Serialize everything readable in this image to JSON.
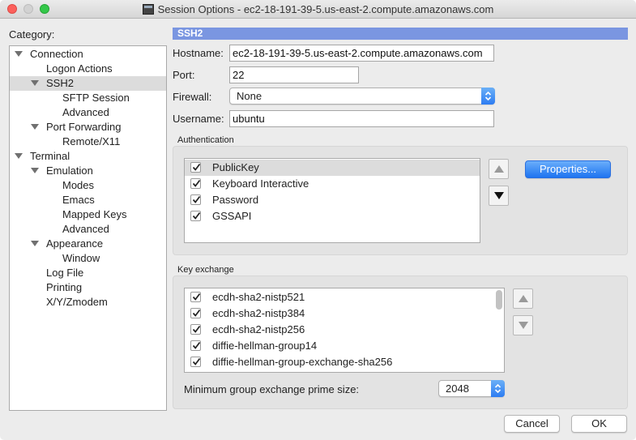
{
  "window": {
    "title": "Session Options - ec2-18-191-39-5.us-east-2.compute.amazonaws.com"
  },
  "category": {
    "label": "Category:",
    "items": [
      {
        "label": "Connection",
        "level": 0,
        "expanded": true,
        "selected": false
      },
      {
        "label": "Logon Actions",
        "level": 1,
        "expanded": false,
        "selected": false
      },
      {
        "label": "SSH2",
        "level": 1,
        "expanded": true,
        "selected": true
      },
      {
        "label": "SFTP Session",
        "level": 2,
        "expanded": false,
        "selected": false
      },
      {
        "label": "Advanced",
        "level": 2,
        "expanded": false,
        "selected": false
      },
      {
        "label": "Port Forwarding",
        "level": 1,
        "expanded": true,
        "selected": false
      },
      {
        "label": "Remote/X11",
        "level": 2,
        "expanded": false,
        "selected": false
      },
      {
        "label": "Terminal",
        "level": 0,
        "expanded": true,
        "selected": false
      },
      {
        "label": "Emulation",
        "level": 1,
        "expanded": true,
        "selected": false
      },
      {
        "label": "Modes",
        "level": 2,
        "expanded": false,
        "selected": false
      },
      {
        "label": "Emacs",
        "level": 2,
        "expanded": false,
        "selected": false
      },
      {
        "label": "Mapped Keys",
        "level": 2,
        "expanded": false,
        "selected": false
      },
      {
        "label": "Advanced",
        "level": 2,
        "expanded": false,
        "selected": false
      },
      {
        "label": "Appearance",
        "level": 1,
        "expanded": true,
        "selected": false
      },
      {
        "label": "Window",
        "level": 2,
        "expanded": false,
        "selected": false
      },
      {
        "label": "Log File",
        "level": 1,
        "expanded": false,
        "selected": false
      },
      {
        "label": "Printing",
        "level": 1,
        "expanded": false,
        "selected": false
      },
      {
        "label": "X/Y/Zmodem",
        "level": 1,
        "expanded": false,
        "selected": false
      }
    ]
  },
  "panel": {
    "header": "SSH2",
    "hostname_label": "Hostname:",
    "hostname_value": "ec2-18-191-39-5.us-east-2.compute.amazonaws.com",
    "port_label": "Port:",
    "port_value": "22",
    "firewall_label": "Firewall:",
    "firewall_value": "None",
    "username_label": "Username:",
    "username_value": "ubuntu"
  },
  "authentication": {
    "title": "Authentication",
    "items": [
      {
        "label": "PublicKey",
        "checked": true,
        "selected": true
      },
      {
        "label": "Keyboard Interactive",
        "checked": true,
        "selected": false
      },
      {
        "label": "Password",
        "checked": true,
        "selected": false
      },
      {
        "label": "GSSAPI",
        "checked": true,
        "selected": false
      }
    ],
    "properties_label": "Properties..."
  },
  "key_exchange": {
    "title": "Key exchange",
    "items": [
      {
        "label": "ecdh-sha2-nistp521",
        "checked": true
      },
      {
        "label": "ecdh-sha2-nistp384",
        "checked": true
      },
      {
        "label": "ecdh-sha2-nistp256",
        "checked": true
      },
      {
        "label": "diffie-hellman-group14",
        "checked": true
      },
      {
        "label": "diffie-hellman-group-exchange-sha256",
        "checked": true
      }
    ],
    "min_prime_label": "Minimum group exchange prime size:",
    "min_prime_value": "2048"
  },
  "footer": {
    "cancel_label": "Cancel",
    "ok_label": "OK"
  },
  "colors": {
    "header_bar": "#7a96e1",
    "accent_blue": "#2c7cf2",
    "selection_gray": "#dcdcdc"
  }
}
